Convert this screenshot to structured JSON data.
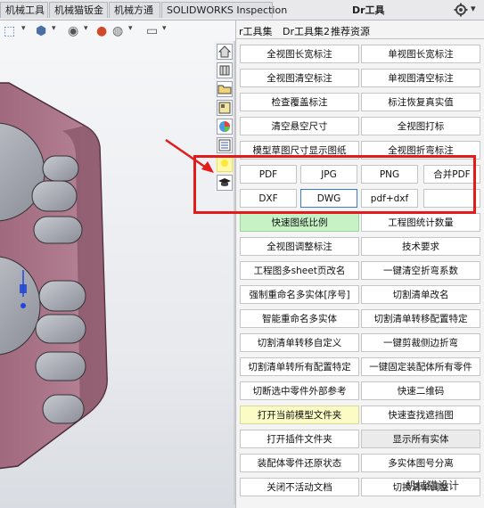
{
  "top_tabs": [
    "机械工具",
    "机械猫钣金",
    "机械方通",
    "SOLIDWORKS Inspection"
  ],
  "panel_title": "Dr工具",
  "panel_tabs": [
    "r工具集",
    "Dr工具集2",
    "推荐资源"
  ],
  "buttons": [
    {
      "label": "全视图长宽标注",
      "style": "normal"
    },
    {
      "label": "单视图长宽标注",
      "style": "normal"
    },
    {
      "label": "全视图清空标注",
      "style": "normal"
    },
    {
      "label": "单视图清空标注",
      "style": "normal"
    },
    {
      "label": "检查覆盖标注",
      "style": "normal"
    },
    {
      "label": "标注恢复真实值",
      "style": "normal"
    },
    {
      "label": "清空悬空尺寸",
      "style": "normal"
    },
    {
      "label": "全视图打标",
      "style": "normal"
    },
    {
      "label": "模型草图尺寸显示图纸",
      "style": "normal"
    },
    {
      "label": "全视图折弯标注",
      "style": "normal"
    },
    {
      "label": "PDF",
      "style": "normal"
    },
    {
      "label": "JPG",
      "style": "normal"
    },
    {
      "label": "PNG",
      "style": "normal"
    },
    {
      "label": "合并PDF",
      "style": "normal"
    },
    {
      "label": "DXF",
      "style": "normal"
    },
    {
      "label": "DWG",
      "style": "selected"
    },
    {
      "label": "pdf+dxf",
      "style": "normal"
    },
    {
      "label": "",
      "style": "normal"
    },
    {
      "label": "快速图纸比例",
      "style": "green"
    },
    {
      "label": "工程图统计数量",
      "style": "normal"
    },
    {
      "label": "全视图调整标注",
      "style": "normal"
    },
    {
      "label": "技术要求",
      "style": "normal"
    },
    {
      "label": "工程图多sheet页改名",
      "style": "normal"
    },
    {
      "label": "一键清空折弯系数",
      "style": "normal"
    },
    {
      "label": "强制重命名多实体[序号]",
      "style": "normal"
    },
    {
      "label": "切割清单改名",
      "style": "normal"
    },
    {
      "label": "智能重命名多实体",
      "style": "normal"
    },
    {
      "label": "切割清单转移配置特定",
      "style": "normal"
    },
    {
      "label": "切割清单转移自定义",
      "style": "normal"
    },
    {
      "label": "一键剪裁侧边折弯",
      "style": "normal"
    },
    {
      "label": "切割清单转所有配置特定",
      "style": "normal"
    },
    {
      "label": "一键固定装配体所有零件",
      "style": "normal"
    },
    {
      "label": "切断选中零件外部参考",
      "style": "normal"
    },
    {
      "label": "快速二维码",
      "style": "normal"
    },
    {
      "label": "打开当前模型文件夹",
      "style": "yellow"
    },
    {
      "label": "快速查找遮挡图",
      "style": "normal"
    },
    {
      "label": "打开插件文件夹",
      "style": "normal"
    },
    {
      "label": "显示所有实体",
      "style": "gray"
    },
    {
      "label": "装配体零件还原状态",
      "style": "normal"
    },
    {
      "label": "多实体图号分离",
      "style": "normal"
    },
    {
      "label": "关闭不活动文档",
      "style": "normal"
    },
    {
      "label": "切换清单调整",
      "style": "normal"
    }
  ],
  "watermark": "机械猫设计",
  "colors": {
    "highlight_box": "#e21b1b",
    "part_body": "#a06a7e",
    "green_button": "#c6f2c6",
    "yellow_button": "#fbfbc6"
  }
}
